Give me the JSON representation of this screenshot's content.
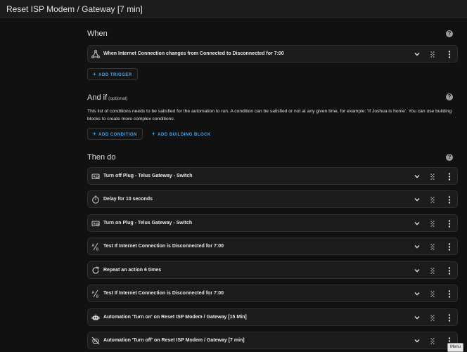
{
  "header": {
    "title": "Reset ISP Modem / Gateway [7 min]"
  },
  "when": {
    "title": "When",
    "trigger": "When Internet Connection changes from Connected to Disconnected for 7:00",
    "add_trigger": "ADD TRIGGER"
  },
  "and_if": {
    "title": "And if",
    "optional": "(optional)",
    "description": "This list of conditions needs to be satisfied for the automation to run. A condition can be satisfied or not at any given time, for example: 'If Joshua is home'. You can use building blocks to create more complex conditions.",
    "add_condition": "ADD CONDITION",
    "add_building_block": "ADD BUILDING BLOCK"
  },
  "then_do": {
    "title": "Then do",
    "actions": [
      {
        "label": "Turn off Plug - Telus Gateway - Switch",
        "icon": "device-icon"
      },
      {
        "label": "Delay for 10 seconds",
        "icon": "timer-icon"
      },
      {
        "label": "Turn on Plug - Telus Gateway - Switch",
        "icon": "device-icon"
      },
      {
        "label": "Test If Internet Connection is Disconnected for 7:00",
        "icon": "condition-icon"
      },
      {
        "label": "Repeat an action 6 times",
        "icon": "refresh-icon"
      },
      {
        "label": "Test If Internet Connection is Disconnected for 7:00",
        "icon": "condition-icon"
      },
      {
        "label": "Automation 'Turn on' on Reset ISP Modem / Gateway [15 Min]",
        "icon": "robot-icon"
      },
      {
        "label": "Automation 'Turn off' on Reset ISP Modem / Gateway [7 min]",
        "icon": "robot-off-icon"
      }
    ]
  },
  "tooltip": "Menu",
  "colors": {
    "background": "#111111",
    "card": "#1c1c1c",
    "accent": "#3fa8ee",
    "text": "#e1e1e1"
  }
}
